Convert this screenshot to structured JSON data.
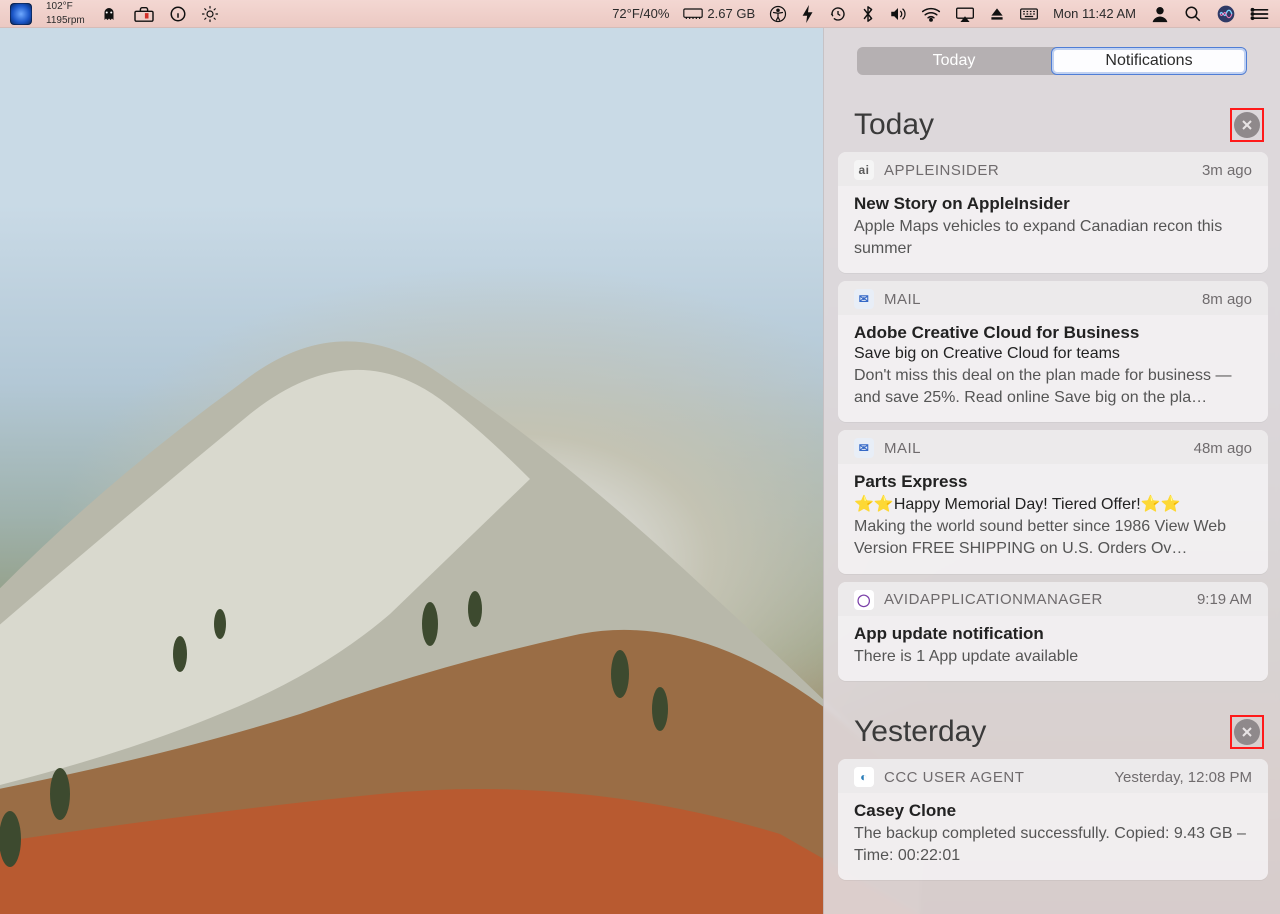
{
  "menubar": {
    "istat_temp": "102°F",
    "istat_rpm": "1195rpm",
    "weather": "72°F/40%",
    "ram": "2.67 GB",
    "clock": "Mon 11:42 AM"
  },
  "nc": {
    "tabs": {
      "today": "Today",
      "notifications": "Notifications"
    },
    "sections": [
      {
        "title": "Today",
        "cards": [
          {
            "app": "APPLEINSIDER",
            "icon": "ai",
            "icon_bg": "#f5f5f5",
            "icon_fg": "#5c5c5c",
            "time": "3m ago",
            "title": "New Story on AppleInsider",
            "subtitle": "",
            "body": "Apple Maps vehicles to expand Canadian recon this summer"
          },
          {
            "app": "MAIL",
            "icon": "✉︎",
            "icon_bg": "#e8eef7",
            "icon_fg": "#3569c7",
            "time": "8m ago",
            "title": "Adobe Creative Cloud for Business",
            "subtitle": "Save big on Creative Cloud for teams",
            "body": "Don't miss this deal on the plan made for business — and save 25%. Read online Save big on the pla…"
          },
          {
            "app": "MAIL",
            "icon": "✉︎",
            "icon_bg": "#e8eef7",
            "icon_fg": "#3569c7",
            "time": "48m ago",
            "title": "Parts Express",
            "subtitle": "⭐⭐Happy Memorial Day! Tiered Offer!⭐⭐",
            "body": "Making the world sound better since 1986 View Web Version FREE SHIPPING on U.S. Orders Ov…"
          },
          {
            "app": "AVIDAPPLICATIONMANAGER",
            "icon": "◯",
            "icon_bg": "#ffffff",
            "icon_fg": "#7a3fa8",
            "time": "9:19 AM",
            "title": "App update notification",
            "subtitle": "",
            "body": "There is 1 App update available"
          }
        ]
      },
      {
        "title": "Yesterday",
        "cards": [
          {
            "app": "CCC USER AGENT",
            "icon": "◐",
            "icon_bg": "#ffffff",
            "icon_fg": "#2a7db8",
            "time": "Yesterday, 12:08 PM",
            "title": "Casey Clone",
            "subtitle": "",
            "body": "The backup completed successfully. Copied: 9.43 GB – Time: 00:22:01"
          }
        ]
      }
    ]
  }
}
